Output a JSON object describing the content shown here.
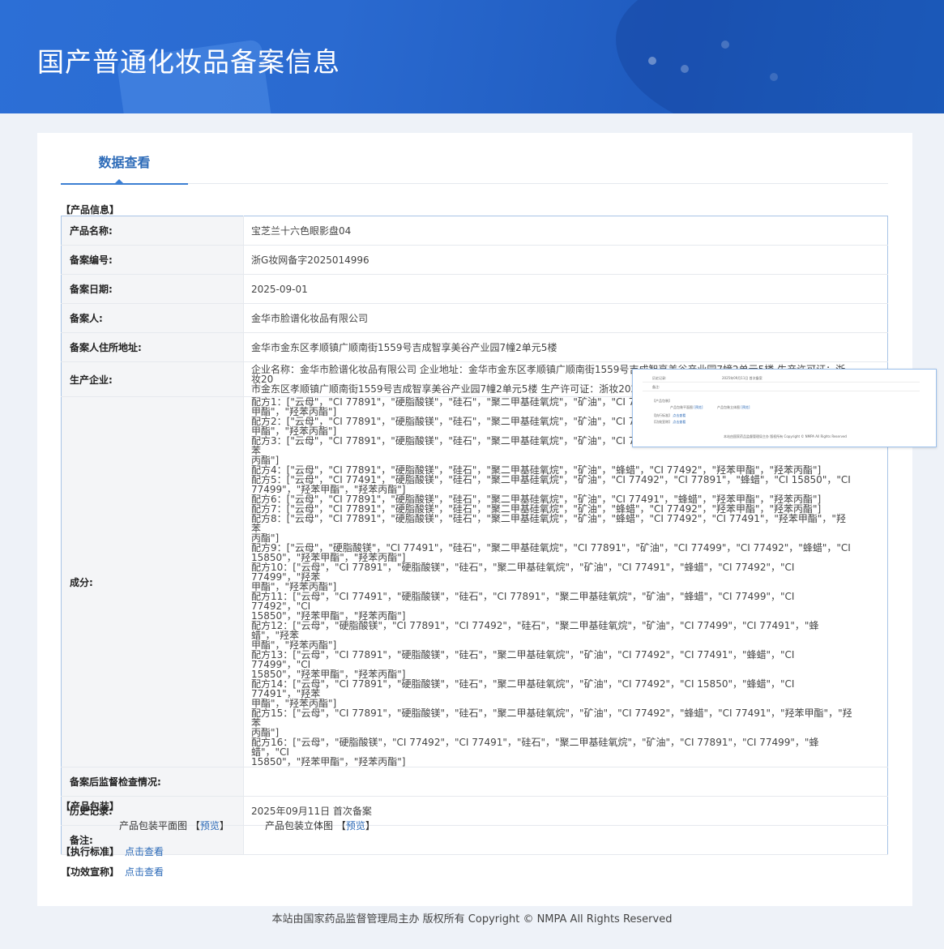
{
  "header": {
    "title": "国产普通化妆品备案信息"
  },
  "tab": {
    "label": "数据查看"
  },
  "sections": {
    "product_info": "【产品信息】",
    "packaging": "【产品包装】",
    "standard": "【执行标准】",
    "efficacy": "【功效宣称】"
  },
  "product": {
    "rows": [
      {
        "label": "产品名称:",
        "value": "宝芝兰十六色眼影盘04"
      },
      {
        "label": "备案编号:",
        "value": "浙G妆网备字2025014996"
      },
      {
        "label": "备案日期:",
        "value": "2025-09-01"
      },
      {
        "label": "备案人:",
        "value": "金华市脸谱化妆品有限公司"
      },
      {
        "label": "备案人住所地址:",
        "value": "金华市金东区孝顺镇广顺南街1559号吉成智享美谷产业园7幢2单元5楼"
      },
      {
        "label": "生产企业:",
        "value": "企业名称：金华市脸谱化妆品有限公司 企业地址：金华市金东区孝顺镇广顺南街1559号吉成智享美谷产业园7幢2单元5楼 生产许可证：浙妆20\n市金东区孝顺镇广顺南街1559号吉成智享美谷产业园7幢2单元5楼 生产许可证：浙妆202"
      },
      {
        "label": "成分:",
        "value": "配方1：[\"云母\"，\"CI 77891\"，\"硬脂酸镁\"，\"硅石\"，\"聚二甲基硅氧烷\"，\"矿油\"，\"CI 77\n甲酯\"，\"羟苯丙酯\"]\n配方2：[\"云母\"，\"CI 77891\"，\"硬脂酸镁\"，\"硅石\"，\"聚二甲基硅氧烷\"，\"矿油\"，\"CI 77\n甲酯\"，\"羟苯丙酯\"]\n配方3：[\"云母\"，\"CI 77891\"，\"硬脂酸镁\"，\"硅石\"，\"聚二甲基硅氧烷\"，\"矿油\"，\"CI 77491\"，\"蜂蜡\"，\"CI 77492\"，\"羟苯甲酯\"，\"羟苯\n丙酯\"]\n配方4：[\"云母\"，\"CI 77891\"，\"硬脂酸镁\"，\"硅石\"，\"聚二甲基硅氧烷\"，\"矿油\"，\"蜂蜡\"，\"CI 77492\"，\"羟苯甲酯\"，\"羟苯丙酯\"]\n配方5：[\"云母\"，\"CI 77491\"，\"硬脂酸镁\"，\"硅石\"，\"聚二甲基硅氧烷\"，\"矿油\"，\"CI 77492\"，\"CI 77891\"，\"蜂蜡\"，\"CI 15850\"，\"CI\n77499\"，\"羟苯甲酯\"，\"羟苯丙酯\"]\n配方6：[\"云母\"，\"CI 77891\"，\"硬脂酸镁\"，\"硅石\"，\"聚二甲基硅氧烷\"，\"矿油\"，\"CI 77491\"，\"蜂蜡\"，\"羟苯甲酯\"，\"羟苯丙酯\"]\n配方7：[\"云母\"，\"CI 77891\"，\"硬脂酸镁\"，\"硅石\"，\"聚二甲基硅氧烷\"，\"矿油\"，\"蜂蜡\"，\"CI 77492\"，\"羟苯甲酯\"，\"羟苯丙酯\"]\n配方8：[\"云母\"，\"CI 77891\"，\"硬脂酸镁\"，\"硅石\"，\"聚二甲基硅氧烷\"，\"矿油\"，\"蜂蜡\"，\"CI 77492\"，\"CI 77491\"，\"羟苯甲酯\"，\"羟苯\n丙酯\"]\n配方9：[\"云母\"，\"硬脂酸镁\"，\"CI 77491\"，\"硅石\"，\"聚二甲基硅氧烷\"，\"CI 77891\"，\"矿油\"，\"CI 77499\"，\"CI 77492\"，\"蜂蜡\"，\"CI\n15850\"，\"羟苯甲酯\"，\"羟苯丙酯\"]\n配方10：[\"云母\"，\"CI 77891\"，\"硬脂酸镁\"，\"硅石\"，\"聚二甲基硅氧烷\"，\"矿油\"，\"CI 77491\"，\"蜂蜡\"，\"CI 77492\"，\"CI 77499\"，\"羟苯\n甲酯\"，\"羟苯丙酯\"]\n配方11：[\"云母\"，\"CI 77491\"，\"硬脂酸镁\"，\"硅石\"，\"CI 77891\"，\"聚二甲基硅氧烷\"，\"矿油\"，\"蜂蜡\"，\"CI 77499\"，\"CI 77492\"，\"CI\n15850\"，\"羟苯甲酯\"，\"羟苯丙酯\"]\n配方12：[\"云母\"，\"硬脂酸镁\"，\"CI 77891\"，\"CI 77492\"，\"硅石\"，\"聚二甲基硅氧烷\"，\"矿油\"，\"CI 77499\"，\"CI 77491\"，\"蜂蜡\"，\"羟苯\n甲酯\"，\"羟苯丙酯\"]\n配方13：[\"云母\"，\"CI 77891\"，\"硬脂酸镁\"，\"硅石\"，\"聚二甲基硅氧烷\"，\"矿油\"，\"CI 77492\"，\"CI 77491\"，\"蜂蜡\"，\"CI 77499\"，\"CI\n15850\"，\"羟苯甲酯\"，\"羟苯丙酯\"]\n配方14：[\"云母\"，\"CI 77891\"，\"硬脂酸镁\"，\"硅石\"，\"聚二甲基硅氧烷\"，\"矿油\"，\"CI 77492\"，\"CI 15850\"，\"蜂蜡\"，\"CI 77491\"，\"羟苯\n甲酯\"，\"羟苯丙酯\"]\n配方15：[\"云母\"，\"CI 77891\"，\"硬脂酸镁\"，\"硅石\"，\"聚二甲基硅氧烷\"，\"矿油\"，\"CI 77492\"，\"蜂蜡\"，\"CI 77491\"，\"羟苯甲酯\"，\"羟苯\n丙酯\"]\n配方16：[\"云母\"，\"硬脂酸镁\"，\"CI 77492\"，\"CI 77491\"，\"硅石\"，\"聚二甲基硅氧烷\"，\"矿油\"，\"CI 77891\"，\"CI 77499\"，\"蜂蜡\"，\"CI\n15850\"，\"羟苯甲酯\"，\"羟苯丙酯\"]"
      },
      {
        "label": "备案后监督检查情况:",
        "value": ""
      },
      {
        "label": "历史记录:",
        "value": "2025年09月11日 首次备案"
      },
      {
        "label": "备注:",
        "value": ""
      }
    ]
  },
  "packaging": {
    "flat_label": "产品包装平面图",
    "flat_link": "预览",
    "solid_label": "产品包装立体图",
    "solid_link": "预览"
  },
  "standard_link": "点击查看",
  "efficacy_link": "点击查看",
  "overlay": {
    "row1_label": "历史记录:",
    "row1_value": "2025年09月11日 首次备案",
    "row2_label": "备注:",
    "packaging": "【产品包装】",
    "flat_label": "产品包装平面图",
    "flat_link": "[预览]",
    "solid_label": "产品包装立体图",
    "solid_link": "[预览]",
    "standard": "【执行标准】",
    "standard_link": "点击查看",
    "efficacy": "【功效宣称】",
    "efficacy_link": "点击查看",
    "footer": "本站由国家药品监督管理局主办 版权所有 Copyright © NMPA All Rights Reserved"
  },
  "footer": {
    "text": "本站由国家药品监督管理局主办 版权所有 Copyright © NMPA All Rights Reserved"
  },
  "colors": {
    "banner": "#2a6ad0",
    "accent": "#2d6bb8",
    "table_border": "#a8c4e6",
    "page_bg": "#eef2f8"
  }
}
